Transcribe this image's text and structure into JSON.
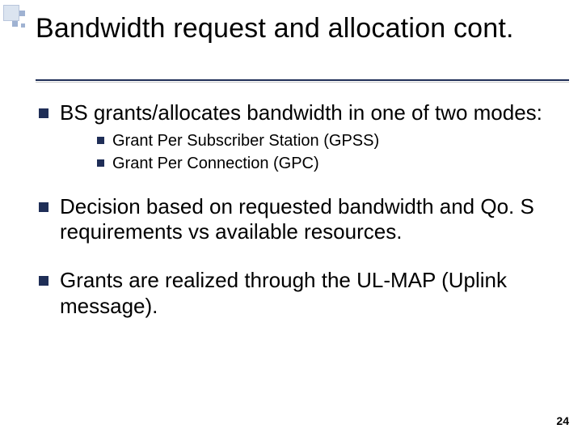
{
  "title": "Bandwidth request and allocation cont.",
  "bullets": [
    {
      "text": "BS grants/allocates bandwidth in one of two modes:",
      "sub": [
        "Grant Per Subscriber Station (GPSS)",
        "Grant Per Connection (GPC)"
      ]
    },
    {
      "text": "Decision based on requested bandwidth and Qo. S requirements vs available resources.",
      "sub": []
    },
    {
      "text": "Grants are realized through the UL-MAP (Uplink message).",
      "sub": []
    }
  ],
  "page_number": "24"
}
